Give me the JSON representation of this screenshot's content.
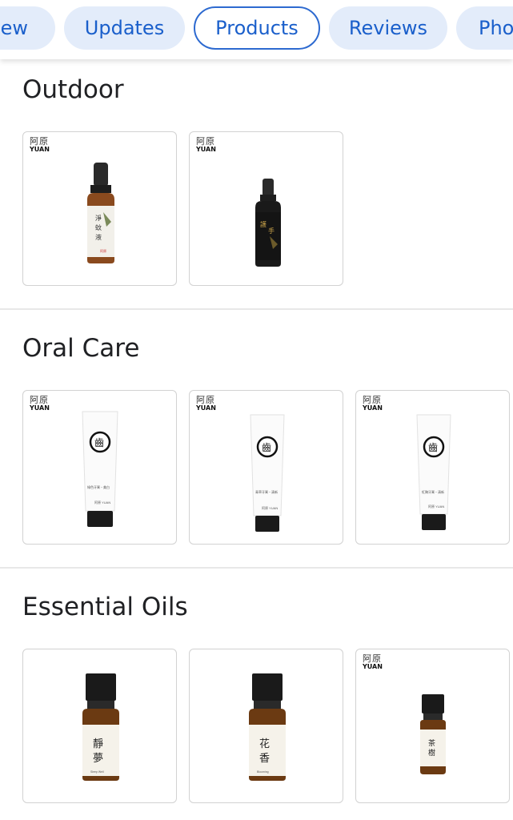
{
  "tabs": [
    {
      "label": "iew"
    },
    {
      "label": "Updates"
    },
    {
      "label": "Products"
    },
    {
      "label": "Reviews"
    },
    {
      "label": "Pho"
    }
  ],
  "active_tab": "Products",
  "brand": {
    "cn": "阿原",
    "en": "YUAN"
  },
  "sections": [
    {
      "title": "Outdoor"
    },
    {
      "title": "Oral Care"
    },
    {
      "title": "Essential Oils"
    }
  ],
  "colors": {
    "chip_bg": "#e3ecfa",
    "chip_text": "#1a5fcb",
    "active_border": "#2d6ad0"
  }
}
